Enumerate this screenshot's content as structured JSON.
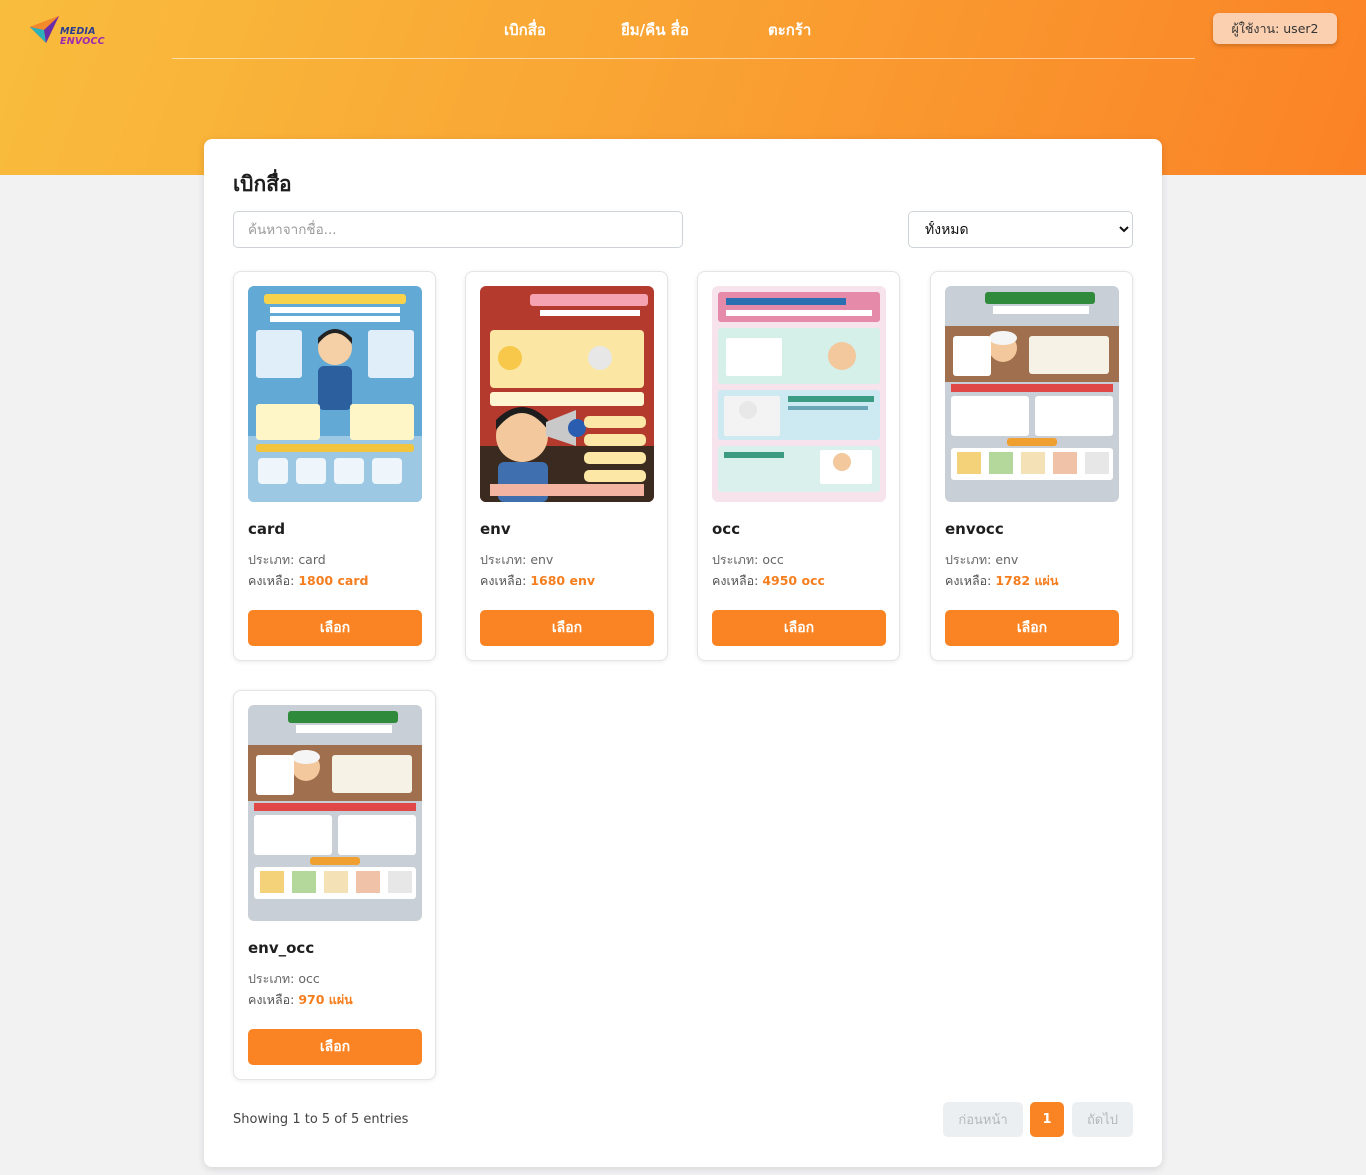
{
  "brand": {
    "line1": "MEDIA",
    "line2": "ENVOCC"
  },
  "nav": [
    {
      "label": "เบิกสื่อ"
    },
    {
      "label": "ยืม/คืน สื่อ"
    },
    {
      "label": "ตะกร้า"
    }
  ],
  "user": {
    "label": "ผู้ใช้งาน: user2"
  },
  "page": {
    "title": "เบิกสื่อ",
    "search_placeholder": "ค้นหาจากชื่อ...",
    "filter_selected": "ทั้งหมด"
  },
  "labels": {
    "type_prefix": "ประเภท: ",
    "stock_prefix": "คงเหลือ: ",
    "select_button": "เลือก"
  },
  "items": [
    {
      "name": "card",
      "type": "card",
      "stock": "1800 card",
      "poster": "blue"
    },
    {
      "name": "env",
      "type": "env",
      "stock": "1680 env",
      "poster": "red"
    },
    {
      "name": "occ",
      "type": "occ",
      "stock": "4950 occ",
      "poster": "pink"
    },
    {
      "name": "envocc",
      "type": "env",
      "stock": "1782 แผ่น",
      "poster": "brown"
    },
    {
      "name": "env_occ",
      "type": "occ",
      "stock": "970 แผ่น",
      "poster": "brown"
    }
  ],
  "footer": {
    "showing": "Showing 1 to 5 of 5 entries"
  },
  "pagination": {
    "prev": "ก่อนหน้า",
    "current": "1",
    "next": "ถัดไป"
  },
  "colors": {
    "accent": "#fa8424",
    "header_start": "#f9bd3d",
    "header_end": "#fb8226"
  }
}
